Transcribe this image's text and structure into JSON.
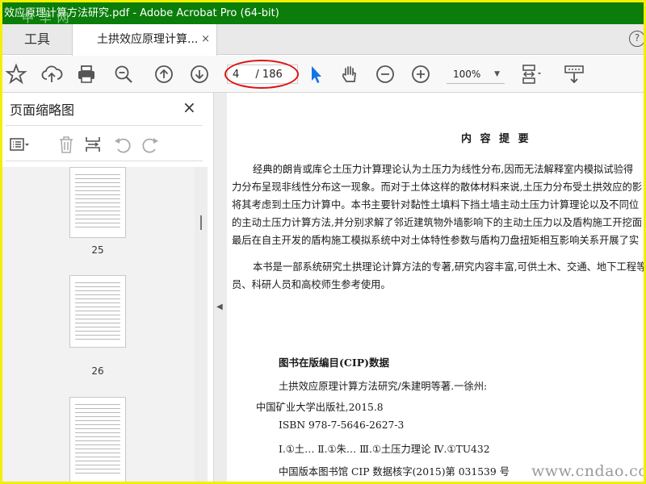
{
  "window": {
    "title": "效应原理计算方法研究.pdf - Adobe Acrobat Pro (64-bit)",
    "watermark_top": "中 华 网"
  },
  "tabs": {
    "tools_label": "工具",
    "doc_label": "土拱效应原理计算...",
    "close_glyph": "×",
    "help_glyph": "?"
  },
  "toolbar": {
    "page_current": "4",
    "page_total": "/ 186",
    "zoom": "100%",
    "icons": [
      "star-icon",
      "cloud-upload-icon",
      "print-icon",
      "zoom-out-magnifier-icon",
      "prev-page-icon",
      "next-page-icon",
      "select-arrow-icon",
      "hand-icon",
      "zoom-minus-icon",
      "zoom-plus-icon",
      "fit-page-icon",
      "scroll-mode-icon"
    ]
  },
  "sidepanel": {
    "title": "页面缩略图",
    "close_glyph": "×",
    "thumbs": [
      {
        "label": "25"
      },
      {
        "label": "26"
      }
    ]
  },
  "document": {
    "heading": "内 容 提 要",
    "paragraph1": [
      "经典的朗肯或库仑土压力计算理论认为土压力为线性分布,因而无法解释室内模拟试验得",
      "力分布呈现非线性分布这一现象。而对于土体这样的散体材料来说,土压力分布受土拱效应的影",
      "将其考虑到土压力计算中。本书主要针对黏性土填料下挡土墙主动土压力计算理论以及不同位",
      "的主动土压力计算方法,并分别求解了邻近建筑物外墙影响下的主动土压力以及盾构施工开挖面",
      "最后在自主开发的盾构施工模拟系统中对土体特性参数与盾构刀盘扭矩相互影响关系开展了实"
    ],
    "paragraph2": [
      "本书是一部系统研究土拱理论计算方法的专著,研究内容丰富,可供土木、交通、地下工程等",
      "员、科研人员和高校师生参考使用。"
    ],
    "cip_title": "图书在版编目(CIP)数据",
    "cip_lines": [
      "土拱效应原理计算方法研究/朱建明等著.一徐州:",
      "中国矿业大学出版社,2015.8",
      "ISBN 978-7-5646-2627-3",
      "Ⅰ.①土… Ⅱ.①朱… Ⅲ.①土压力理论 Ⅳ.①TU432",
      "中国版本图书馆 CIP 数据核字(2015)第 031539 号"
    ],
    "watermark_bottom": "www.cndao.com"
  },
  "colors": {
    "titlebar": "#0a7d0a",
    "highlight_ellipse": "#d11111",
    "frame": "#f2f000",
    "select_arrow": "#1473e6"
  }
}
